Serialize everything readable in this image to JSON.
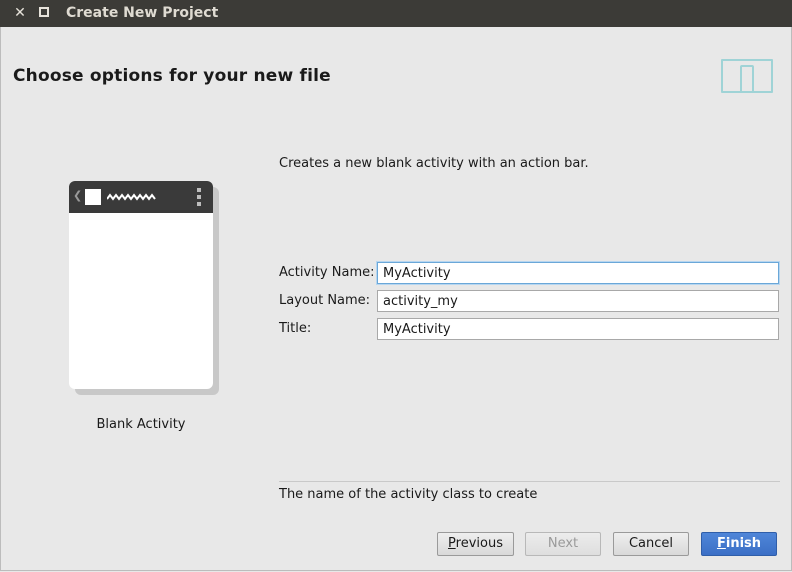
{
  "window": {
    "title": "Create New Project",
    "close_glyph": "✕"
  },
  "page": {
    "heading": "Choose options for your new file",
    "icon": "device-icon"
  },
  "template": {
    "name": "Blank Activity",
    "description": "Creates a new blank activity with an action bar."
  },
  "form": {
    "activity_name": {
      "label": "Activity Name:",
      "value": "MyActivity"
    },
    "layout_name": {
      "label": "Layout Name:",
      "value": "activity_my"
    },
    "title": {
      "label": "Title:",
      "value": "MyActivity"
    }
  },
  "hint": "The name of the activity class to create",
  "buttons": {
    "previous_mnemonic": "P",
    "previous_rest": "revious",
    "next": "Next",
    "cancel": "Cancel",
    "finish_mnemonic": "F",
    "finish_rest": "inish",
    "next_enabled": false
  },
  "colors": {
    "titlebar": "#3c3b37",
    "accent_blue": "#3b6fc6",
    "icon_teal": "#9fd3d6"
  }
}
